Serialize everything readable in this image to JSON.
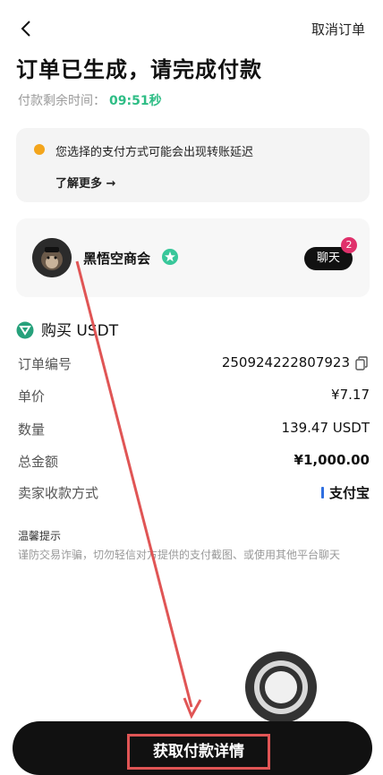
{
  "header": {
    "cancel_label": "取消订单",
    "title": "订单已生成，请完成付款",
    "timer_label": "付款剩余时间：",
    "timer_value": "09:51秒"
  },
  "notice": {
    "message": "您选择的支付方式可能会出现转账延迟",
    "more": "了解更多 →"
  },
  "seller": {
    "name": "黑悟空商会",
    "chat_label": "聊天",
    "chat_badge": "2"
  },
  "order": {
    "heading": "购买 USDT",
    "rows": [
      {
        "label": "订单编号",
        "value": "250924222807923"
      },
      {
        "label": "单价",
        "value": "¥7.17"
      },
      {
        "label": "数量",
        "value": "139.47 USDT"
      },
      {
        "label": "总金额",
        "value": "¥1,000.00"
      },
      {
        "label": "卖家收款方式",
        "value": "支付宝"
      }
    ]
  },
  "tips": {
    "title": "温馨提示",
    "text": "谨防交易诈骗，切勿轻信对方提供的支付截图、或使用其他平台聊天"
  },
  "cta": {
    "label": "获取付款详情"
  },
  "colors": {
    "accent_green": "#2ebd85",
    "annotation_red": "#e05555"
  }
}
